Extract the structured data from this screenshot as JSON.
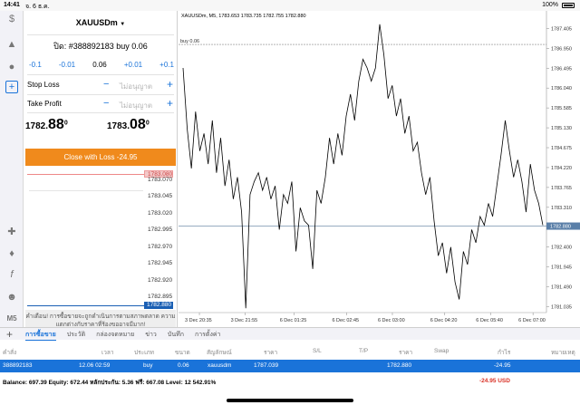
{
  "status_bar": {
    "time": "14:41",
    "date": "จ. 6 ธ.ค.",
    "battery_percent": "100%"
  },
  "left_toolbar": {
    "icons": [
      "quotes-icon",
      "trade-icon",
      "chat-icon",
      "new-order-icon",
      "crosshair-icon",
      "indicators-icon",
      "objects-icon",
      "users-icon"
    ],
    "timeframe": "M5"
  },
  "panel": {
    "symbol": "XAUUSDm",
    "order_title": "ปิด: #388892183 buy 0.06",
    "steps": [
      "-0.1",
      "-0.01",
      "0.06",
      "+0.01",
      "+0.1"
    ],
    "stop_loss": {
      "label": "Stop Loss",
      "value": "ไม่อนุญาต"
    },
    "take_profit": {
      "label": "Take Profit",
      "value": "ไม่อนุญาต"
    },
    "bid": {
      "lead": "1782.",
      "big": "88",
      "sup": "0"
    },
    "ask": {
      "lead": "1783.",
      "big": "08",
      "sup": "0"
    },
    "close_button": "Close with Loss -24.95",
    "dom_prices": [
      "1783.070",
      "1783.045",
      "1783.020",
      "1782.995",
      "1782.970",
      "1782.945",
      "1782.920",
      "1782.895"
    ],
    "dom_ask_tag": "1783.080",
    "dom_bid_tag": "1782.880",
    "warning": "คำเตือน! การซื้อขายจะถูกดำเนินการตามสภาพตลาด ความแตกต่างกับราคาที่ร้องขออาจมีมาก!"
  },
  "chart": {
    "info": "XAUUSDm, M5, 1783.653 1783.735 1782.755 1782.880",
    "order_label": "buy 0.06",
    "price_tag": "1782.880"
  },
  "chart_data": {
    "type": "line",
    "symbol": "XAUUSDm",
    "timeframe": "M5",
    "y_ticks": [
      "1787.405",
      "1786.950",
      "1786.495",
      "1786.040",
      "1785.585",
      "1785.130",
      "1784.675",
      "1784.220",
      "1783.765",
      "1783.310",
      "1782.855",
      "1782.400",
      "1781.945",
      "1781.490",
      "1781.035"
    ],
    "x_ticks": [
      "3 Dec 20:35",
      "3 Dec 21:55",
      "6 Dec 01:25",
      "6 Dec 02:45",
      "6 Dec 03:00",
      "6 Dec 04:20",
      "6 Dec 05:40",
      "6 Dec 07:00"
    ],
    "ylim": [
      1780.9,
      1787.6
    ],
    "buy_level": 1787.039,
    "current_price": 1782.88,
    "close_series": [
      1786.5,
      1785.1,
      1784.2,
      1785.5,
      1784.6,
      1785.0,
      1784.3,
      1785.3,
      1784.1,
      1784.9,
      1783.8,
      1784.4,
      1783.5,
      1784.0,
      1783.2,
      1781.0,
      1783.6,
      1783.9,
      1784.1,
      1783.7,
      1784.0,
      1783.5,
      1783.8,
      1782.8,
      1783.6,
      1783.4,
      1783.9,
      1782.3,
      1783.3,
      1783.0,
      1782.9,
      1781.9,
      1783.7,
      1783.4,
      1784.0,
      1784.9,
      1784.3,
      1785.0,
      1784.5,
      1785.4,
      1785.9,
      1785.3,
      1786.2,
      1786.7,
      1786.5,
      1786.2,
      1786.5,
      1787.5,
      1786.8,
      1785.8,
      1786.1,
      1785.4,
      1785.8,
      1785.0,
      1785.4,
      1784.6,
      1784.8,
      1784.1,
      1783.6,
      1784.0,
      1783.0,
      1782.2,
      1782.5,
      1781.8,
      1782.4,
      1781.6,
      1781.2,
      1782.3,
      1782.0,
      1782.8,
      1782.5,
      1783.1,
      1782.9,
      1783.4,
      1783.1,
      1783.8,
      1784.5,
      1785.3,
      1784.6,
      1784.0,
      1784.4,
      1783.9,
      1783.2,
      1784.3,
      1783.7,
      1783.4,
      1782.9
    ]
  },
  "bottom_tabs": [
    "การซื้อขาย",
    "ประวัติ",
    "กล่องจดหมาย",
    "ข่าว",
    "บันทึก",
    "การตั้งค่า"
  ],
  "table": {
    "headers": [
      "คำสั่ง",
      "เวลา",
      "ประเภท",
      "ขนาด",
      "สัญลักษณ์",
      "ราคา",
      "S/L",
      "T/P",
      "ราคา",
      "Swap",
      "กำไร",
      "หมายเหตุ"
    ],
    "row": [
      "388892183",
      "12.06 02:59",
      "buy",
      "0.06",
      "xauusdm",
      "1787.039",
      "",
      "",
      "1782.880",
      "",
      "-24.95",
      ""
    ]
  },
  "balance": {
    "text": "Balance: 697.39 Equity: 672.44 หลักประกัน: 5.36 ฟรี: 667.08 Level: 12 542.91%",
    "profit": "-24.95  USD"
  }
}
